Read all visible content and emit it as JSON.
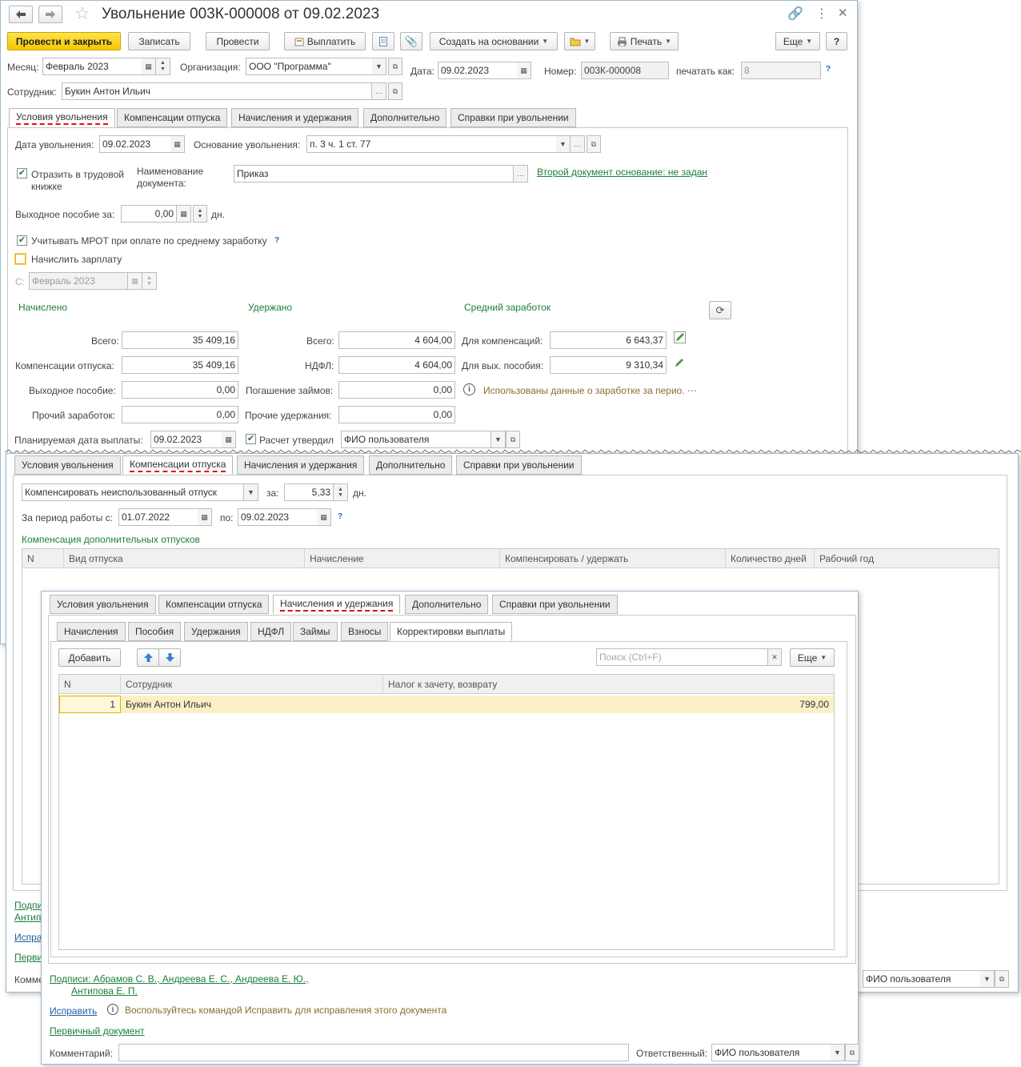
{
  "title": "Увольнение 003К-000008 от 09.02.2023",
  "toolbar": {
    "post_close": "Провести и закрыть",
    "save": "Записать",
    "post": "Провести",
    "pay": "Выплатить",
    "create_based": "Создать на основании",
    "print": "Печать",
    "more": "Еще",
    "help": "?"
  },
  "header": {
    "month_label": "Месяц:",
    "month_value": "Февраль 2023",
    "org_label": "Организация:",
    "org_value": "ООО \"Программа\"",
    "date_label": "Дата:",
    "date_value": "09.02.2023",
    "number_label": "Номер:",
    "number_value": "003К-000008",
    "print_as_label": "печатать как:",
    "print_as_value": "8",
    "employee_label": "Сотрудник:",
    "employee_value": "Букин Антон Ильич"
  },
  "tabs": [
    "Условия увольнения",
    "Компенсации отпуска",
    "Начисления и удержания",
    "Дополнительно",
    "Справки при увольнении"
  ],
  "conditions": {
    "dismissal_date_label": "Дата увольнения:",
    "dismissal_date": "09.02.2023",
    "basis_label": "Основание увольнения:",
    "basis_value": "п. 3 ч. 1 ст. 77",
    "reflect_label_1": "Отразить в трудовой",
    "reflect_label_2": "книжке",
    "doc_name_label_1": "Наименование",
    "doc_name_label_2": "документа:",
    "doc_name_value": "Приказ",
    "second_doc_link": "Второй документ основание: не задан",
    "severance_label": "Выходное пособие за:",
    "severance_value": "0,00",
    "days_unit": "дн.",
    "mrot_label": "Учитывать МРОТ при оплате по среднему заработку",
    "accrue_salary_label": "Начислить зарплату",
    "from_label": "С:",
    "from_value": "Февраль 2023",
    "accrued_header": "Начислено",
    "withheld_header": "Удержано",
    "avg_header": "Средний заработок",
    "total_label": "Всего:",
    "total_accrued": "35 409,16",
    "vacation_comp_label": "Компенсации отпуска:",
    "vacation_comp": "35 409,16",
    "severance_pay_label": "Выходное пособие:",
    "severance_pay": "0,00",
    "other_earnings_label": "Прочий заработок:",
    "other_earnings": "0,00",
    "withheld_total_label": "Всего:",
    "withheld_total": "4 604,00",
    "ndfl_label": "НДФЛ:",
    "ndfl": "4 604,00",
    "loans_label": "Погашение займов:",
    "loans": "0,00",
    "other_withholdings_label": "Прочие удержания:",
    "other_withholdings": "0,00",
    "for_comp_label": "Для компенсаций:",
    "for_comp": "6 643,37",
    "for_sev_label": "Для вых. пособия:",
    "for_sev": "9 310,34",
    "info_text": "Использованы данные о заработке за перио. ⋯",
    "planned_date_label": "Планируемая дата выплаты:",
    "planned_date": "09.02.2023",
    "approved_label": "Расчет утвердил",
    "approved_value": "ФИО пользователя"
  },
  "vacation": {
    "compensate_value": "Компенсировать неиспользованный отпуск",
    "for_label": "за:",
    "days_value": "5,33",
    "days_unit": "дн.",
    "period_label": "За период работы с:",
    "period_from": "01.07.2022",
    "to_label": "по:",
    "period_to": "09.02.2023",
    "extra_header": "Компенсация дополнительных отпусков",
    "columns": [
      "N",
      "Вид отпуска",
      "Начисление",
      "Компенсировать / удержать",
      "Количество дней",
      "Рабочий год"
    ],
    "responsible_value": "ФИО пользователя",
    "bg_footer": [
      "Подпи",
      "Антип",
      "Испра",
      "Перви",
      "Комме"
    ]
  },
  "charges": {
    "subtabs": [
      "Начисления",
      "Пособия",
      "Удержания",
      "НДФЛ",
      "Займы",
      "Взносы",
      "Корректировки выплаты"
    ],
    "add": "Добавить",
    "search_placeholder": "Поиск (Ctrl+F)",
    "more": "Еще",
    "columns": [
      "N",
      "Сотрудник",
      "Налог к зачету, возврату"
    ],
    "rows": [
      {
        "n": "1",
        "employee": "Букин Антон Ильич",
        "amount": "799,00"
      }
    ],
    "signatures_1": "Подписи: Абрамов С. В., Андреева Е. С., Андреева Е. Ю.,",
    "signatures_2": "Антипова Е. П.",
    "fix_link": "Исправить",
    "fix_hint": "Воспользуйтесь командой Исправить для исправления этого документа",
    "primary_doc": "Первичный документ",
    "comment_label": "Комментарий:",
    "responsible_label": "Ответственный:",
    "responsible_value": "ФИО пользователя"
  }
}
